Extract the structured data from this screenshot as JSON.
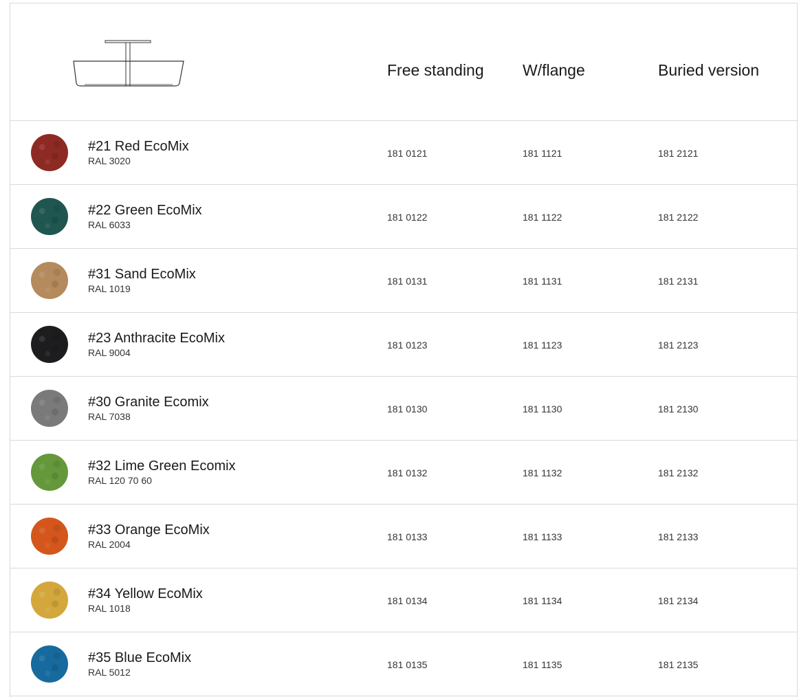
{
  "header": {
    "columns": [
      "Free standing",
      "W/flange",
      "Buried version"
    ]
  },
  "rows": [
    {
      "name": "#21 Red EcoMix",
      "ral": "RAL 3020",
      "free": "181 0121",
      "flange": "181 1121",
      "buried": "181 2121",
      "color": "#8e2a24"
    },
    {
      "name": "#22 Green EcoMix",
      "ral": "RAL 6033",
      "free": "181 0122",
      "flange": "181 1122",
      "buried": "181 2122",
      "color": "#1f5650"
    },
    {
      "name": "#31 Sand EcoMix",
      "ral": "RAL 1019",
      "free": "181 0131",
      "flange": "181 1131",
      "buried": "181 2131",
      "color": "#b58a5c"
    },
    {
      "name": "#23 Anthracite EcoMix",
      "ral": "RAL 9004",
      "free": "181 0123",
      "flange": "181 1123",
      "buried": "181 2123",
      "color": "#1d1d1f"
    },
    {
      "name": "#30 Granite Ecomix",
      "ral": "RAL 7038",
      "free": "181 0130",
      "flange": "181 1130",
      "buried": "181 2130",
      "color": "#7a7a7a"
    },
    {
      "name": "#32 Lime Green Ecomix",
      "ral": "RAL 120 70 60",
      "free": "181 0132",
      "flange": "181 1132",
      "buried": "181 2132",
      "color": "#64983a"
    },
    {
      "name": "#33 Orange EcoMix",
      "ral": "RAL 2004",
      "free": "181 0133",
      "flange": "181 1133",
      "buried": "181 2133",
      "color": "#d4561c"
    },
    {
      "name": "#34  Yellow EcoMix",
      "ral": "RAL 1018",
      "free": "181 0134",
      "flange": "181 1134",
      "buried": "181 2134",
      "color": "#d3a73c"
    },
    {
      "name": "#35 Blue EcoMix",
      "ral": "RAL 5012",
      "free": "181 0135",
      "flange": "181 1135",
      "buried": "181 2135",
      "color": "#176a9e"
    }
  ]
}
